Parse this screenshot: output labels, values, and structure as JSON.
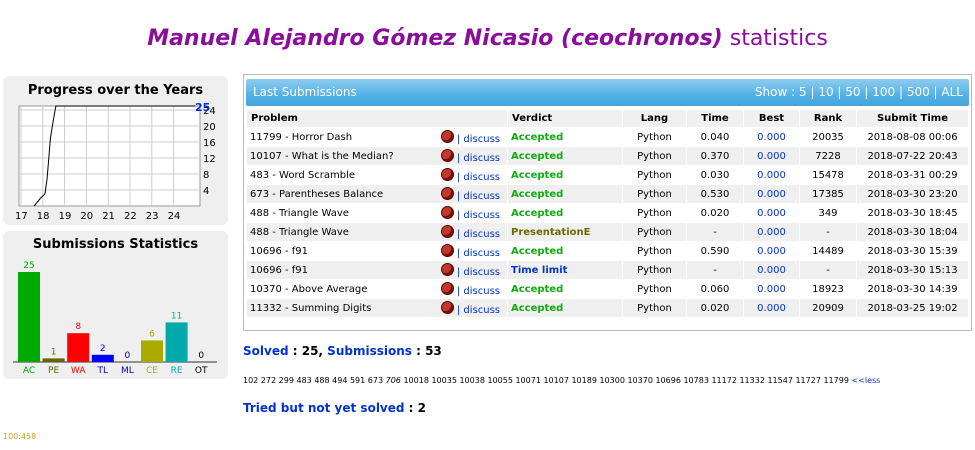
{
  "header": {
    "name": "Manuel Alejandro Gómez Nicasio (ceochronos)",
    "suffix": "statistics"
  },
  "progress": {
    "title": "Progress over the Years",
    "x_labels": [
      "17",
      "18",
      "19",
      "20",
      "21",
      "22",
      "23",
      "24"
    ],
    "y_labels": [
      "4",
      "8",
      "12",
      "16",
      "20",
      "24"
    ],
    "max_label": "25",
    "chart_data": {
      "type": "line",
      "x": [
        "2017.6",
        "2017.9",
        "2018.1",
        "2018.2",
        "2018.35",
        "2018.5",
        "2018.6",
        "2025"
      ],
      "values": [
        0,
        2,
        3,
        7,
        17,
        22,
        25,
        25
      ],
      "ylim": [
        0,
        25
      ]
    }
  },
  "stats": {
    "title": "Submissions Statistics",
    "chart_data": {
      "type": "bar",
      "categories": [
        "AC",
        "PE",
        "WA",
        "TL",
        "ML",
        "CE",
        "RE",
        "OT"
      ],
      "values": [
        25,
        1,
        8,
        2,
        0,
        6,
        11,
        0
      ],
      "colors": [
        "#00aa00",
        "#666600",
        "#ff0000",
        "#0000ff",
        "#0000aa",
        "#aaaa00",
        "#00aaaa",
        "#000000"
      ]
    }
  },
  "submissions": {
    "header_label": "Last Submissions",
    "show_label": "Show :",
    "show_options": [
      "5",
      "10",
      "50",
      "100",
      "500",
      "ALL"
    ],
    "columns": [
      "Problem",
      "Verdict",
      "Lang",
      "Time",
      "Best",
      "Rank",
      "Submit Time"
    ],
    "discuss_label": "discuss",
    "rows": [
      {
        "problem": "11799 - Horror Dash",
        "verdict": "Accepted",
        "vclass": "acc",
        "lang": "Python",
        "time": "0.040",
        "best": "0.000",
        "rank": "20035",
        "submit": "2018-08-08 00:06"
      },
      {
        "problem": "10107 - What is the Median?",
        "verdict": "Accepted",
        "vclass": "acc",
        "lang": "Python",
        "time": "0.370",
        "best": "0.000",
        "rank": "7228",
        "submit": "2018-07-22 20:43"
      },
      {
        "problem": "483 - Word Scramble",
        "verdict": "Accepted",
        "vclass": "acc",
        "lang": "Python",
        "time": "0.030",
        "best": "0.000",
        "rank": "15478",
        "submit": "2018-03-31 00:29"
      },
      {
        "problem": "673 - Parentheses Balance",
        "verdict": "Accepted",
        "vclass": "acc",
        "lang": "Python",
        "time": "0.530",
        "best": "0.000",
        "rank": "17385",
        "submit": "2018-03-30 23:20"
      },
      {
        "problem": "488 - Triangle Wave",
        "verdict": "Accepted",
        "vclass": "acc",
        "lang": "Python",
        "time": "0.020",
        "best": "0.000",
        "rank": "349",
        "submit": "2018-03-30 18:45"
      },
      {
        "problem": "488 - Triangle Wave",
        "verdict": "PresentationE",
        "vclass": "pe",
        "lang": "Python",
        "time": "-",
        "best": "0.000",
        "rank": "-",
        "submit": "2018-03-30 18:04"
      },
      {
        "problem": "10696 - f91",
        "verdict": "Accepted",
        "vclass": "acc",
        "lang": "Python",
        "time": "0.590",
        "best": "0.000",
        "rank": "14489",
        "submit": "2018-03-30 15:39"
      },
      {
        "problem": "10696 - f91",
        "verdict": "Time limit",
        "vclass": "tl",
        "lang": "Python",
        "time": "-",
        "best": "0.000",
        "rank": "-",
        "submit": "2018-03-30 15:13"
      },
      {
        "problem": "10370 - Above Average",
        "verdict": "Accepted",
        "vclass": "acc",
        "lang": "Python",
        "time": "0.060",
        "best": "0.000",
        "rank": "18923",
        "submit": "2018-03-30 14:39"
      },
      {
        "problem": "11332 - Summing Digits",
        "verdict": "Accepted",
        "vclass": "acc",
        "lang": "Python",
        "time": "0.020",
        "best": "0.000",
        "rank": "20909",
        "submit": "2018-03-25 19:02"
      }
    ]
  },
  "summary": {
    "solved_label": "Solved",
    "solved": "25",
    "subs_label": "Submissions",
    "subs": "53"
  },
  "problem_list": [
    "102",
    "272",
    "299",
    "483",
    "488",
    "494",
    "591",
    "673",
    "706",
    "10018",
    "10035",
    "10038",
    "10055",
    "10071",
    "10107",
    "10189",
    "10300",
    "10370",
    "10696",
    "10783",
    "11172",
    "11332",
    "11547",
    "11727",
    "11799"
  ],
  "less_label": "<<less",
  "tried": {
    "label": "Tried but not yet solved",
    "value": "2"
  },
  "footer": "100:458"
}
